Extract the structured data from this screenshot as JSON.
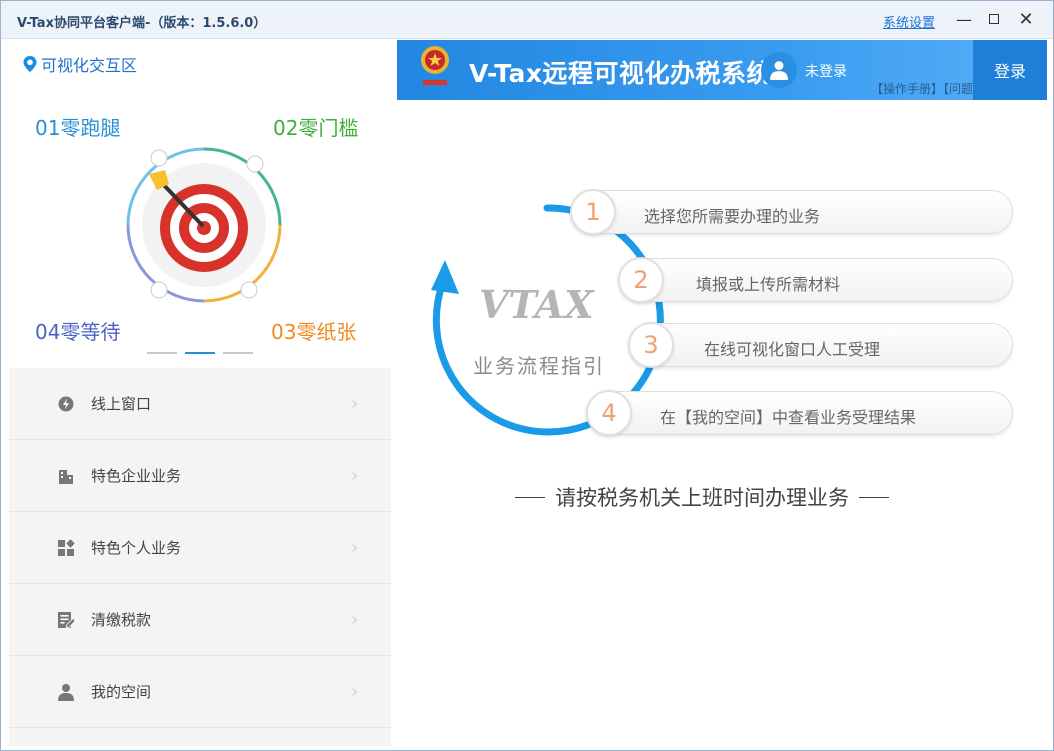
{
  "window": {
    "title": "V-Tax协同平台客户端-（版本：1.5.6.0）",
    "settings_link": "系统设置",
    "minimize_glyph": "—",
    "close_glyph": "✕"
  },
  "left_panel": {
    "section_title": "可视化交互区",
    "corner_labels": {
      "c01": "01零跑腿",
      "c02": "02零门槛",
      "c03": "03零纸张",
      "c04": "04零等待"
    },
    "carousel": {
      "count": 3,
      "active_index": 1
    },
    "menu": [
      {
        "label": "线上窗口",
        "icon": "lightning-icon"
      },
      {
        "label": "特色企业业务",
        "icon": "building-icon"
      },
      {
        "label": "特色个人业务",
        "icon": "grid-icon"
      },
      {
        "label": "清缴税款",
        "icon": "edit-document-icon"
      },
      {
        "label": "我的空间",
        "icon": "user-icon"
      }
    ],
    "chevron": "›"
  },
  "right_panel": {
    "banner": {
      "title": "V-Tax远程可视化办税系统",
      "login_status": "未登录",
      "manual_links": "【操作手册】【问题",
      "login_button": "登录"
    },
    "flow": {
      "logo_text": "VTAX",
      "guide_text": "业务流程指引",
      "steps": [
        {
          "number": "1",
          "text": "选择您所需要办理的业务"
        },
        {
          "number": "2",
          "text": "填报或上传所需材料"
        },
        {
          "number": "3",
          "text": "在线可视化窗口人工受理"
        },
        {
          "number": "4",
          "text": "在【我的空间】中查看业务受理结果"
        }
      ]
    },
    "notice": "请按税务机关上班时间办理业务"
  },
  "colors": {
    "accent_blue": "#2386e0",
    "ring_blue": "#1a9be8",
    "step_number": "#f0a070",
    "label_01": "#2a8fd6",
    "label_02": "#3fae3b",
    "label_03": "#f08a1e",
    "label_04": "#4b62c4"
  }
}
